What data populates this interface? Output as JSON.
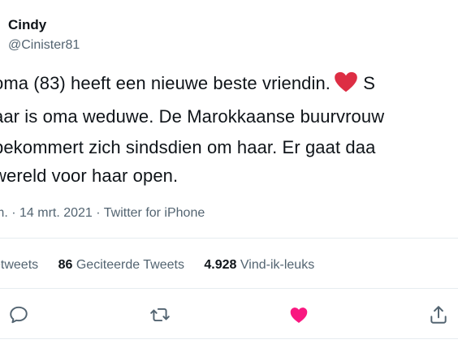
{
  "user": {
    "name": "Cindy",
    "handle": "@Cinister81"
  },
  "tweet": {
    "line1": "oma (83) heeft een nieuwe beste vriendin.",
    "line1_after_emoji": "S",
    "line2": "aar is oma weduwe. De Marokkaanse buurvrouw",
    "line3": "bekommert zich sindsdien om haar. Er gaat daa",
    "line4": "wereld voor haar open.",
    "emoji": "red-heart-emoji"
  },
  "meta": {
    "text": "m. · 14 mrt. 2021 · Twitter for iPhone"
  },
  "stats": {
    "retweets_label": "etweets",
    "quotes_count": "86",
    "quotes_label": "Geciteerde Tweets",
    "likes_count": "4.928",
    "likes_label": "Vind-ik-leuks"
  },
  "actions": {
    "reply_icon": "reply-icon",
    "retweet_icon": "retweet-icon",
    "like_icon": "heart-icon",
    "share_icon": "share-icon"
  },
  "colors": {
    "text": "#0f1419",
    "secondary": "#536471",
    "icon": "#536471",
    "like": "#f91880",
    "divider": "#e6ecf0",
    "heart_emoji": "#dd2e44"
  }
}
